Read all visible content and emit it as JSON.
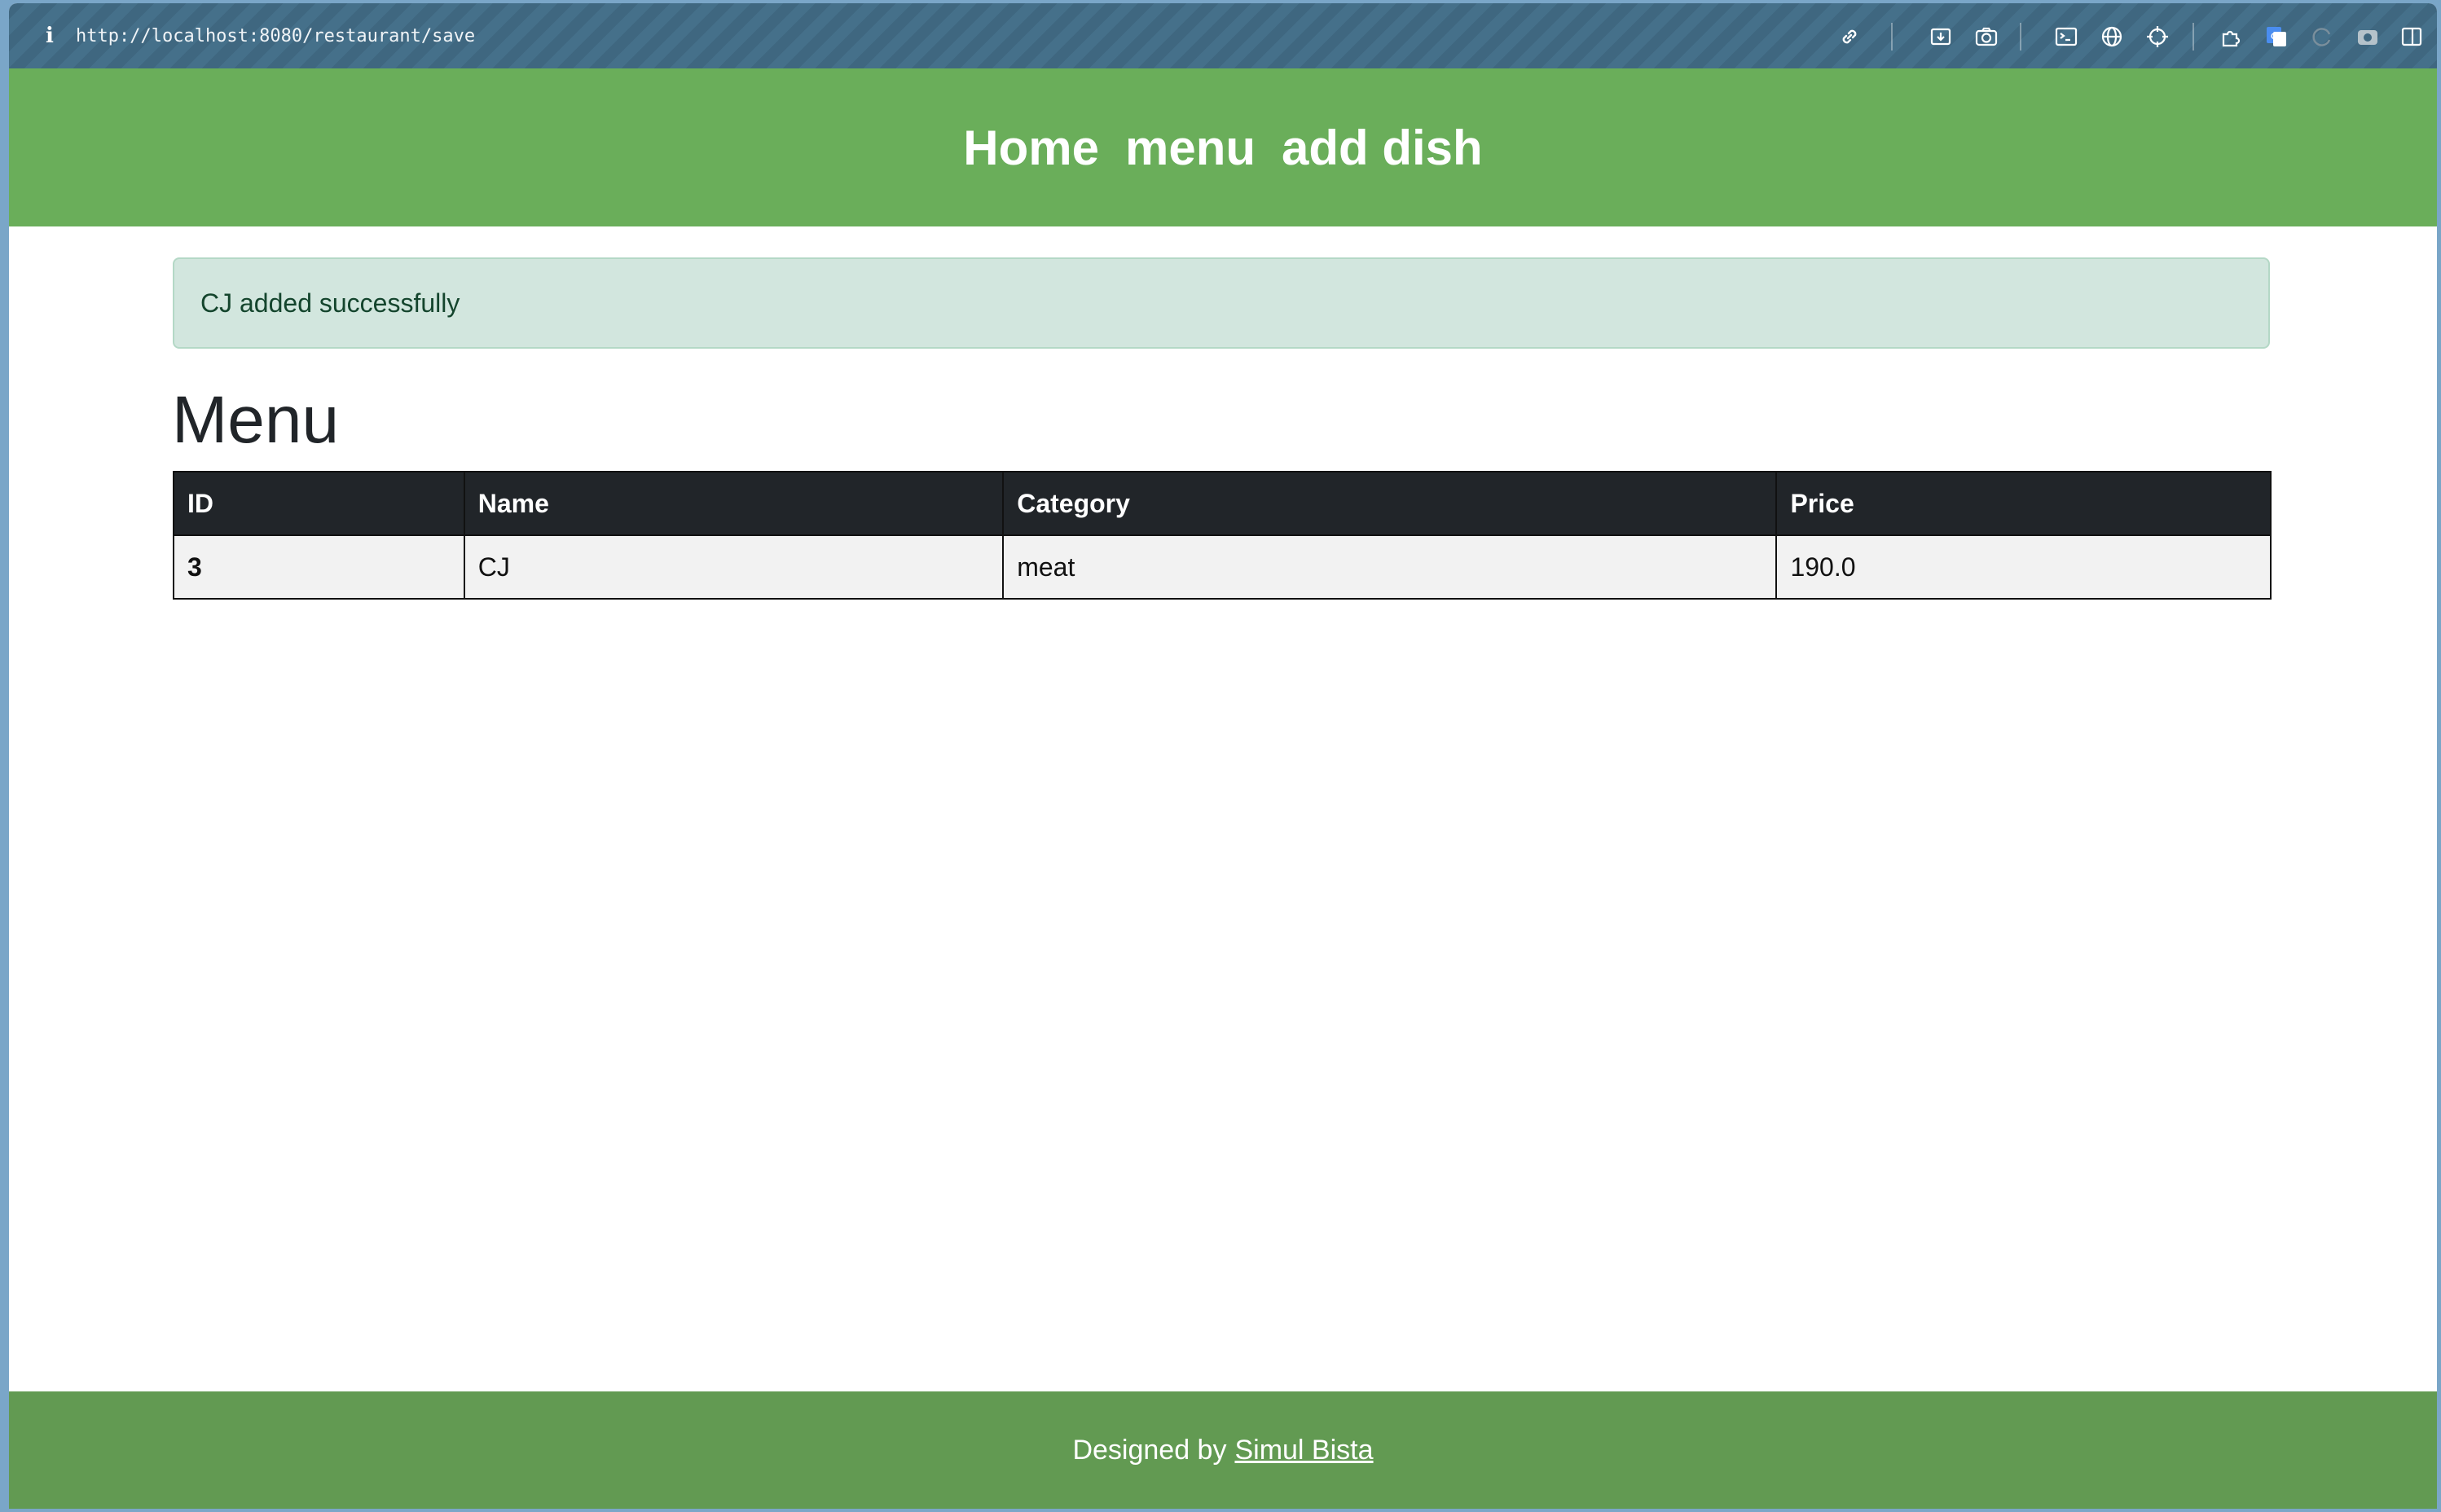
{
  "browser": {
    "url": "http://localhost:8080/restaurant/save",
    "info_glyph": "i",
    "toolbar_icons": [
      "link-icon",
      "download-icon",
      "camera-icon",
      "terminal-icon",
      "globe-icon",
      "crosshair-icon",
      "extension-icon",
      "translate-icon",
      "reload-icon",
      "screenshot-icon",
      "sidebar-icon"
    ]
  },
  "nav": {
    "home": "Home",
    "menu": "menu",
    "add_dish": "add dish"
  },
  "alert": {
    "message": "CJ added successfully"
  },
  "page": {
    "title": "Menu"
  },
  "table": {
    "headers": [
      "ID",
      "Name",
      "Category",
      "Price"
    ],
    "rows": [
      {
        "id": "3",
        "name": "CJ",
        "category": "meat",
        "price": "190.0"
      }
    ]
  },
  "footer": {
    "prefix": "Designed by",
    "author": "Simul Bista"
  },
  "colors": {
    "header_green": "#6aae5a",
    "footer_green": "#629a52",
    "alert_bg": "#d2e6de",
    "table_header": "#212529"
  }
}
